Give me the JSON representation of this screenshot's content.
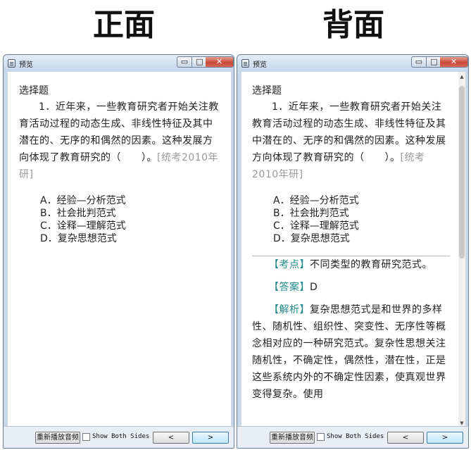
{
  "labels": {
    "front": "正面",
    "back": "背面"
  },
  "window": {
    "title": "预览",
    "min_icon": "minimize-icon",
    "max_icon": "maximize-icon",
    "close_icon": "close-icon",
    "min_glyph": "▭",
    "max_glyph": "□",
    "close_glyph": "✕"
  },
  "front": {
    "heading": "选择题",
    "question_text": "1．近年来，一些教育研究者开始关注教育活动过程的动态生成、非线性特征及其中潜在的、无序的和偶然的因素。这种发展方向体现了教育研究的（　　）。",
    "question_source": "[统考2010年研]",
    "options": [
      "A．经验—分析范式",
      "B．社会批判范式",
      "C．诠释—理解范式",
      "D．复杂思想范式"
    ]
  },
  "back": {
    "heading": "选择题",
    "question_text": "1．近年来，一些教育研究者开始关注教育活动过程的动态生成、非线性特征及其中潜在的、无序的和偶然的因素。这种发展方向体现了教育研究的（　　）。",
    "question_source": "[统考2010年研]",
    "options": [
      "A．经验—分析范式",
      "B．社会批判范式",
      "C．诠释—理解范式",
      "D．复杂思想范式"
    ],
    "kaodian_tag": "【考点】",
    "kaodian_text": "不同类型的教育研究范式。",
    "answer_tag": "【答案】",
    "answer_text": "D",
    "analysis_tag": "【解析】",
    "analysis_text": "复杂思想范式是和世界的多样性、随机性、组织性、突变性、无序性等概念相对应的一种研究范式。复杂性思想关注随机性，不确定性，偶然性，潜在性，正是这些系统内外的不确定性因素，使真观世界变得复杂。使用"
  },
  "bottom": {
    "replay_label": "重新播放音频",
    "show_both_label": "Show Both Sides",
    "show_both_checked": false,
    "prev_glyph": "<",
    "next_glyph": ">"
  },
  "scroll": {
    "up_glyph": "▲",
    "down_glyph": "▼"
  }
}
